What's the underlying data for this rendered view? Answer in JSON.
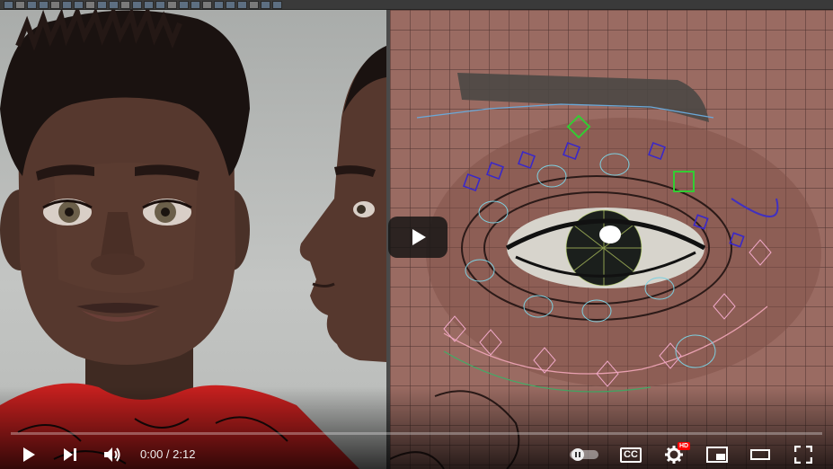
{
  "player": {
    "time_current": "0:00",
    "time_separator": " / ",
    "time_total": "2:12",
    "progress_fraction": 0.0,
    "cc_label": "CC",
    "hd_badge": "HD",
    "accent_color": "#ff0000"
  },
  "icons": {
    "play": "play-icon",
    "next": "skip-next-icon",
    "volume": "volume-icon",
    "autoplay": "autoplay-toggle-icon",
    "captions": "captions-icon",
    "settings": "gear-icon",
    "miniplayer": "miniplayer-icon",
    "theater": "theater-mode-icon",
    "fullscreen": "fullscreen-icon"
  }
}
